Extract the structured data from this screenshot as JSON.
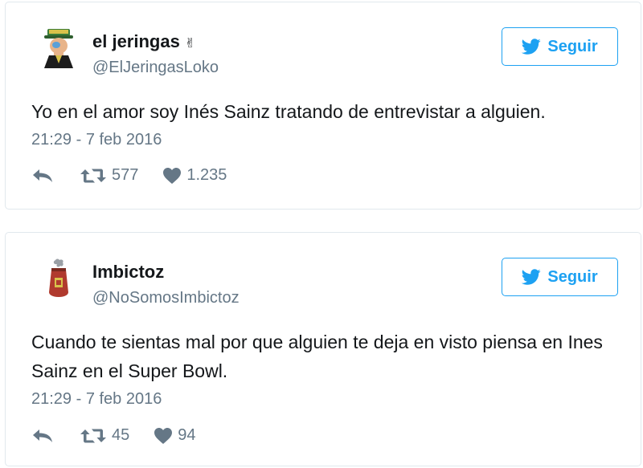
{
  "tweets": [
    {
      "display_name": "el jeringas",
      "name_emoji": "✌",
      "handle": "@ElJeringasLoko",
      "follow_label": "Seguir",
      "text": "Yo en el amor soy Inés Sainz tratando de entrevistar a alguien.",
      "timestamp": "21:29 - 7 feb 2016",
      "retweets": "577",
      "likes": "1.235"
    },
    {
      "display_name": "Imbictoz",
      "handle": "@NoSomosImbictoz",
      "follow_label": "Seguir",
      "text": "Cuando te sientas mal por que alguien te deja en visto piensa en Ines Sainz en el Super Bowl.",
      "timestamp": "21:29 - 7 feb 2016",
      "retweets": "45",
      "likes": "94"
    }
  ],
  "colors": {
    "accent": "#1da1f2",
    "muted": "#657786",
    "text": "#14171a",
    "border": "#e1e8ed"
  },
  "icons": {
    "follow": "twitter-bird-icon",
    "reply": "reply-icon",
    "retweet": "retweet-icon",
    "like": "heart-icon"
  }
}
